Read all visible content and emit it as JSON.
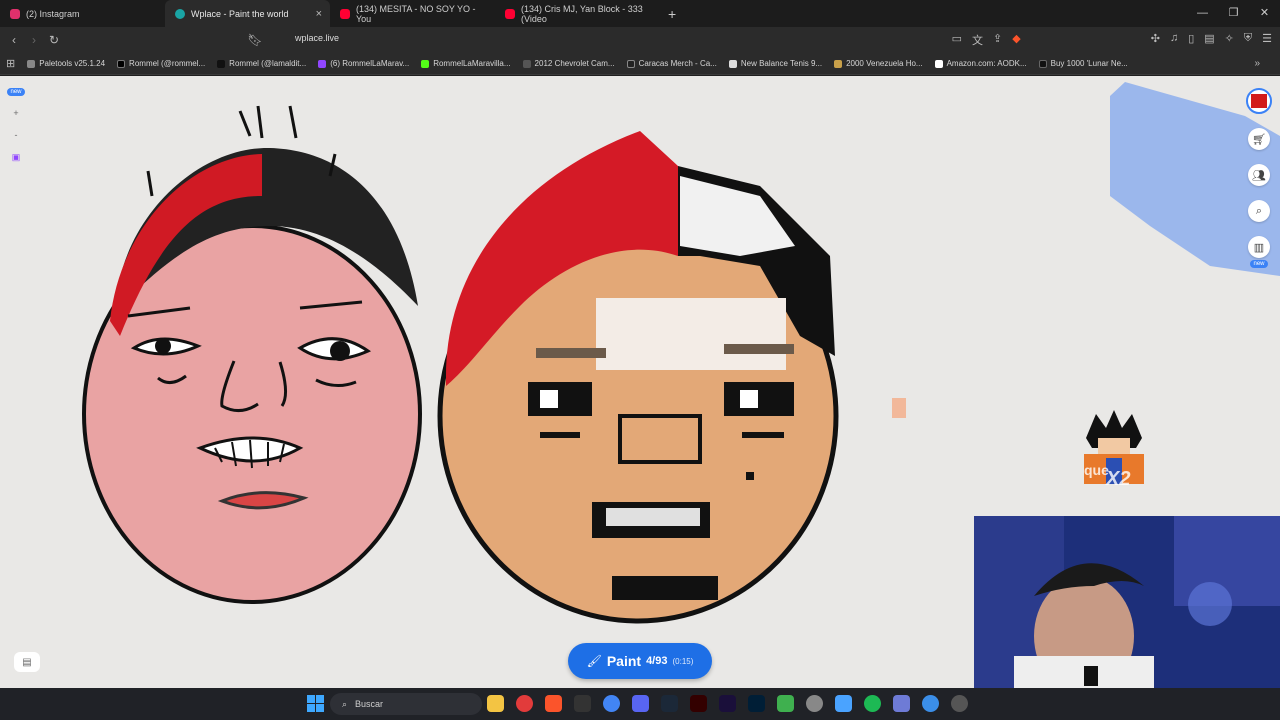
{
  "browser": {
    "tabs": [
      {
        "title": "(2) Instagram",
        "color": "#e1306c"
      },
      {
        "title": "Wplace - Paint the world",
        "color": "#1aa5a5",
        "active": true
      },
      {
        "title": "(134) MESITA - NO SOY YO - You",
        "color": "#ff0033"
      },
      {
        "title": "(134) Cris MJ, Yan Block - 333 (Video",
        "color": "#ff0033"
      }
    ],
    "close_glyph": "×",
    "new_tab": "+",
    "url": "wplace.live",
    "bookmarks": [
      "Paletools v25.1.24",
      "Rommel (@rommel...",
      "Rommel (@lamaldit...",
      "(6) RommelLaMarav...",
      "RommelLaMaravilla...",
      "2012 Chevrolet Cam...",
      "Caracas Merch - Ca...",
      "New Balance Tenis 9...",
      "2000 Venezuela Ho...",
      "Amazon.com: AODK...",
      "Buy 1000 'Lunar Ne..."
    ]
  },
  "left_tools": {
    "badge": "new",
    "zoom_in": "+",
    "zoom_out": "-"
  },
  "right_tools": {
    "avatar_count": "9",
    "badge": "new"
  },
  "paint_button": {
    "label": "Paint",
    "count": "4/93",
    "timer": "(0:15)"
  },
  "overlay": {
    "goku_text_1": "que",
    "goku_text_2": "X2"
  },
  "taskbar": {
    "search_placeholder": "Buscar"
  },
  "colors": {
    "accent": "#1e6fe6",
    "canvas": "#e9e8e6",
    "red": "#d41a26",
    "skin": "#e3a877"
  }
}
